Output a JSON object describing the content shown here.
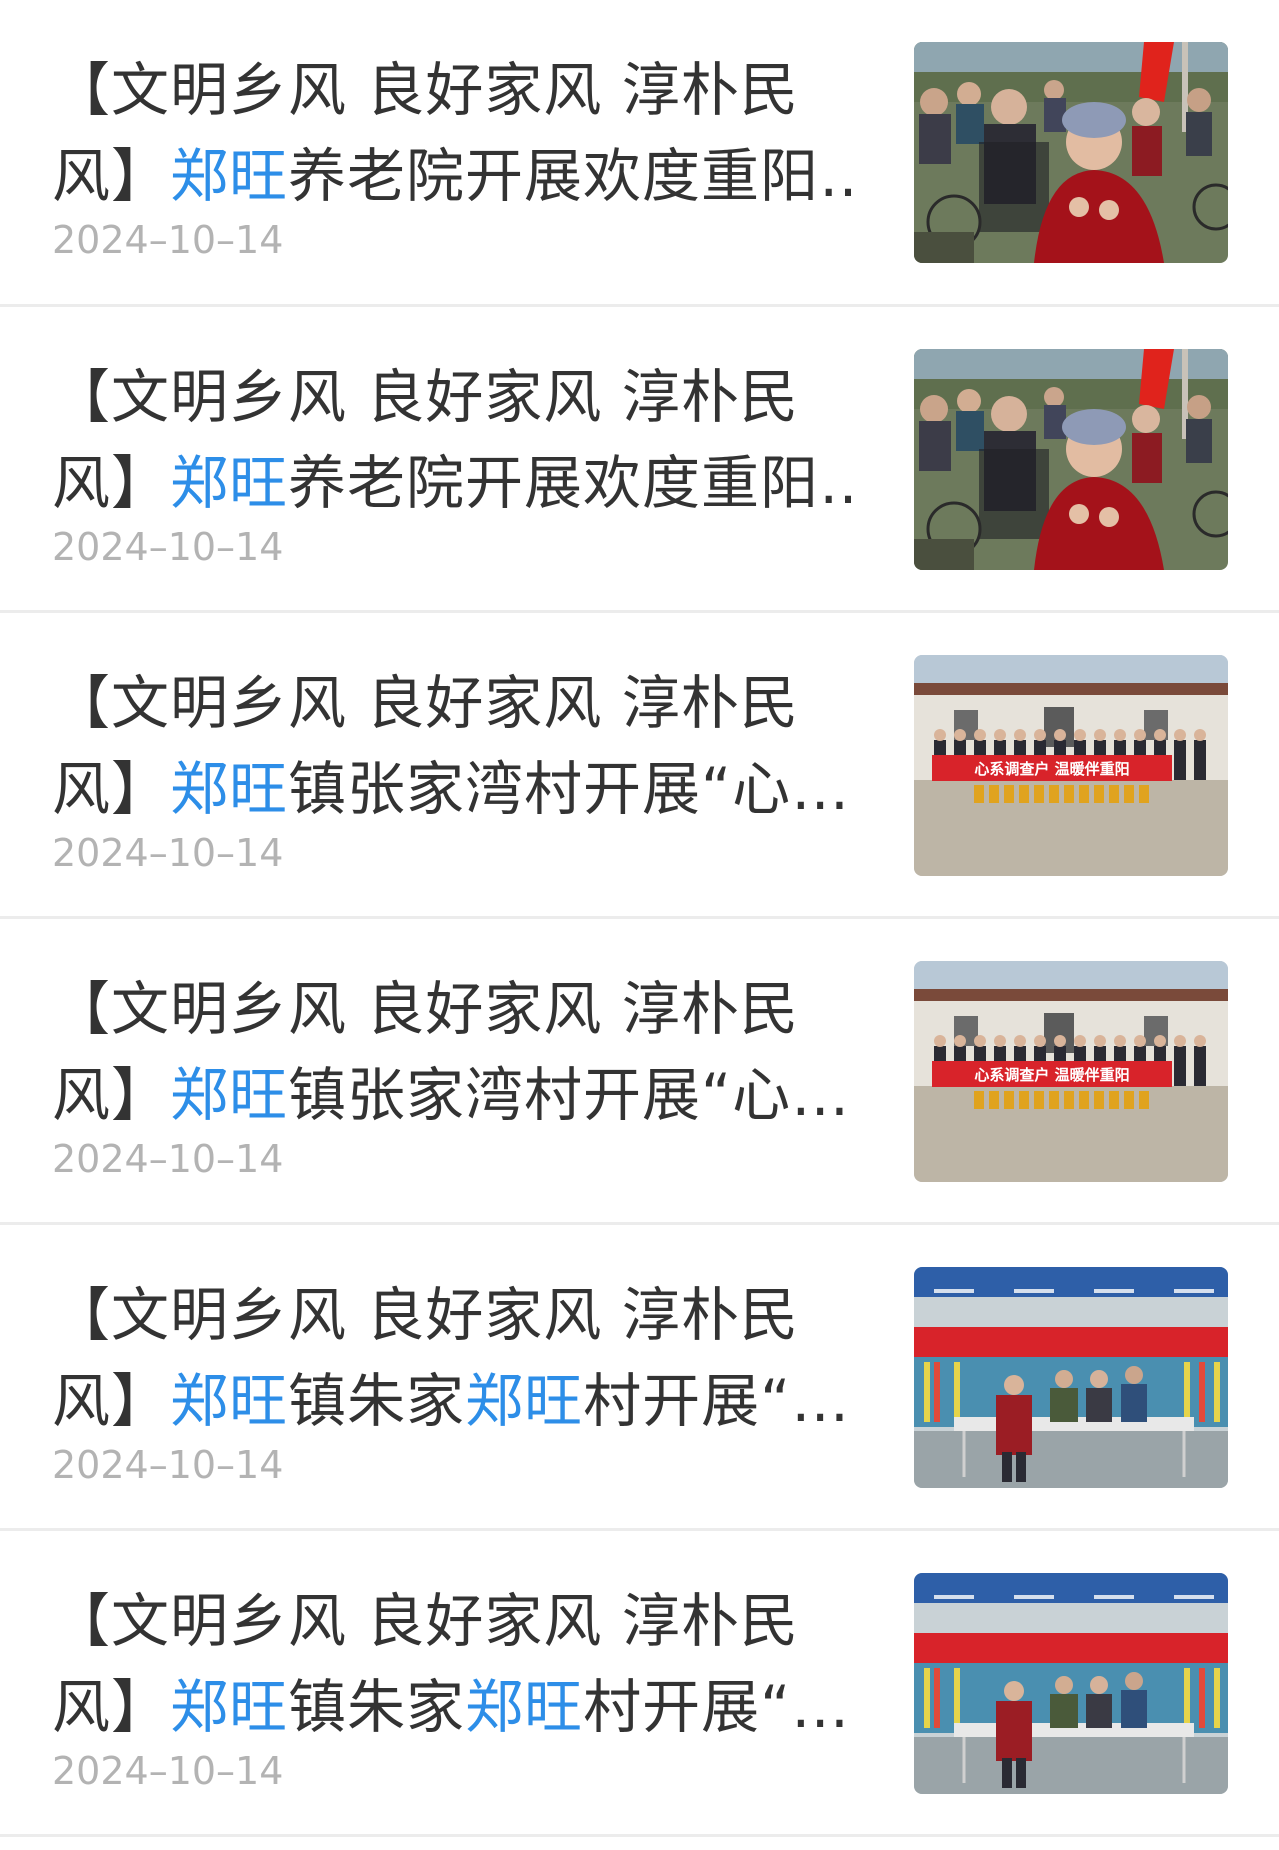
{
  "news_list": [
    {
      "title_line1": "【文明乡风 良好家风 淳朴民",
      "title_line2": [
        {
          "text": "风】",
          "highlight": false
        },
        {
          "text": "郑旺",
          "highlight": true
        },
        {
          "text": "养老院开展欢度重阳…",
          "highlight": false
        }
      ],
      "date": "2024–10–14",
      "image": "elderly-care-photo"
    },
    {
      "title_line1": "【文明乡风 良好家风 淳朴民",
      "title_line2": [
        {
          "text": "风】",
          "highlight": false
        },
        {
          "text": "郑旺",
          "highlight": true
        },
        {
          "text": "养老院开展欢度重阳…",
          "highlight": false
        }
      ],
      "date": "2024–10–14",
      "image": "elderly-care-photo"
    },
    {
      "title_line1": "【文明乡风 良好家风 淳朴民",
      "title_line2": [
        {
          "text": "风】",
          "highlight": false
        },
        {
          "text": "郑旺",
          "highlight": true
        },
        {
          "text": "镇张家湾村开展“心…",
          "highlight": false
        }
      ],
      "date": "2024–10–14",
      "image": "village-group-photo",
      "banner_text": "心系调查户 温暖伴重阳"
    },
    {
      "title_line1": "【文明乡风 良好家风 淳朴民",
      "title_line2": [
        {
          "text": "风】",
          "highlight": false
        },
        {
          "text": "郑旺",
          "highlight": true
        },
        {
          "text": "镇张家湾村开展“心…",
          "highlight": false
        }
      ],
      "date": "2024–10–14",
      "image": "village-group-photo",
      "banner_text": "心系调查户 温暖伴重阳"
    },
    {
      "title_line1": "【文明乡风 良好家风 淳朴民",
      "title_line2": [
        {
          "text": "风】",
          "highlight": false
        },
        {
          "text": "郑旺",
          "highlight": true
        },
        {
          "text": "镇朱家",
          "highlight": false
        },
        {
          "text": "郑旺",
          "highlight": true
        },
        {
          "text": "村开展“…",
          "highlight": false
        }
      ],
      "date": "2024–10–14",
      "image": "dumpling-event-photo"
    },
    {
      "title_line1": "【文明乡风 良好家风 淳朴民",
      "title_line2": [
        {
          "text": "风】",
          "highlight": false
        },
        {
          "text": "郑旺",
          "highlight": true
        },
        {
          "text": "镇朱家",
          "highlight": false
        },
        {
          "text": "郑旺",
          "highlight": true
        },
        {
          "text": "村开展“…",
          "highlight": false
        }
      ],
      "date": "2024–10–14",
      "image": "dumpling-event-photo"
    }
  ],
  "colors": {
    "title": "#333333",
    "highlight": "#2d8ee8",
    "date": "#b3b3b3",
    "divider": "#ececec"
  }
}
